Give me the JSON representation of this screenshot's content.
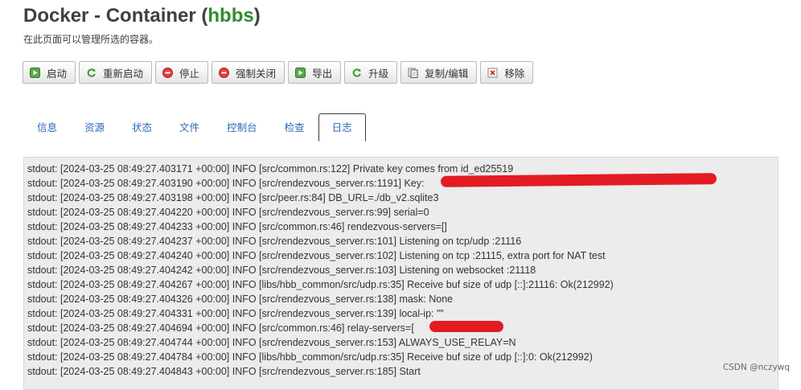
{
  "header": {
    "title_prefix": "Docker - Container (",
    "container_name": "hbbs",
    "title_suffix": ")",
    "subtitle": "在此页面可以管理所选的容器。"
  },
  "toolbar": [
    {
      "label": "启动",
      "icon": "play-icon"
    },
    {
      "label": "重新启动",
      "icon": "refresh-icon"
    },
    {
      "label": "停止",
      "icon": "stop-icon"
    },
    {
      "label": "强制关闭",
      "icon": "stop-icon"
    },
    {
      "label": "导出",
      "icon": "export-icon"
    },
    {
      "label": "升级",
      "icon": "refresh-icon"
    },
    {
      "label": "复制/编辑",
      "icon": "copy-icon"
    },
    {
      "label": "移除",
      "icon": "remove-icon"
    }
  ],
  "tabs": [
    {
      "label": "信息",
      "active": false
    },
    {
      "label": "资源",
      "active": false
    },
    {
      "label": "状态",
      "active": false
    },
    {
      "label": "文件",
      "active": false
    },
    {
      "label": "控制台",
      "active": false
    },
    {
      "label": "检查",
      "active": false
    },
    {
      "label": "日志",
      "active": true
    }
  ],
  "log_lines": [
    "stdout: [2024-03-25 08:49:27.403171 +00:00] INFO [src/common.rs:122] Private key comes from id_ed25519",
    "stdout: [2024-03-25 08:49:27.403190 +00:00] INFO [src/rendezvous_server.rs:1191] Key:",
    "stdout: [2024-03-25 08:49:27.403198 +00:00] INFO [src/peer.rs:84] DB_URL=./db_v2.sqlite3",
    "stdout: [2024-03-25 08:49:27.404220 +00:00] INFO [src/rendezvous_server.rs:99] serial=0",
    "stdout: [2024-03-25 08:49:27.404233 +00:00] INFO [src/common.rs:46] rendezvous-servers=[]",
    "stdout: [2024-03-25 08:49:27.404237 +00:00] INFO [src/rendezvous_server.rs:101] Listening on tcp/udp :21116",
    "stdout: [2024-03-25 08:49:27.404240 +00:00] INFO [src/rendezvous_server.rs:102] Listening on tcp :21115, extra port for NAT test",
    "stdout: [2024-03-25 08:49:27.404242 +00:00] INFO [src/rendezvous_server.rs:103] Listening on websocket :21118",
    "stdout: [2024-03-25 08:49:27.404267 +00:00] INFO [libs/hbb_common/src/udp.rs:35] Receive buf size of udp [::]:21116: Ok(212992)",
    "stdout: [2024-03-25 08:49:27.404326 +00:00] INFO [src/rendezvous_server.rs:138] mask: None",
    "stdout: [2024-03-25 08:49:27.404331 +00:00] INFO [src/rendezvous_server.rs:139] local-ip: \"\"",
    "stdout: [2024-03-25 08:49:27.404694 +00:00] INFO [src/common.rs:46] relay-servers=[",
    "stdout: [2024-03-25 08:49:27.404744 +00:00] INFO [src/rendezvous_server.rs:153] ALWAYS_USE_RELAY=N",
    "stdout: [2024-03-25 08:49:27.404784 +00:00] INFO [libs/hbb_common/src/udp.rs:35] Receive buf size of udp [::]:0: Ok(212992)",
    "stdout: [2024-03-25 08:49:27.404843 +00:00] INFO [src/rendezvous_server.rs:185] Start"
  ],
  "watermark": "CSDN @nczywq",
  "colors": {
    "accent_green": "#2e8b2e",
    "tab_link": "#2b6bb5",
    "redaction": "#e31b23"
  }
}
